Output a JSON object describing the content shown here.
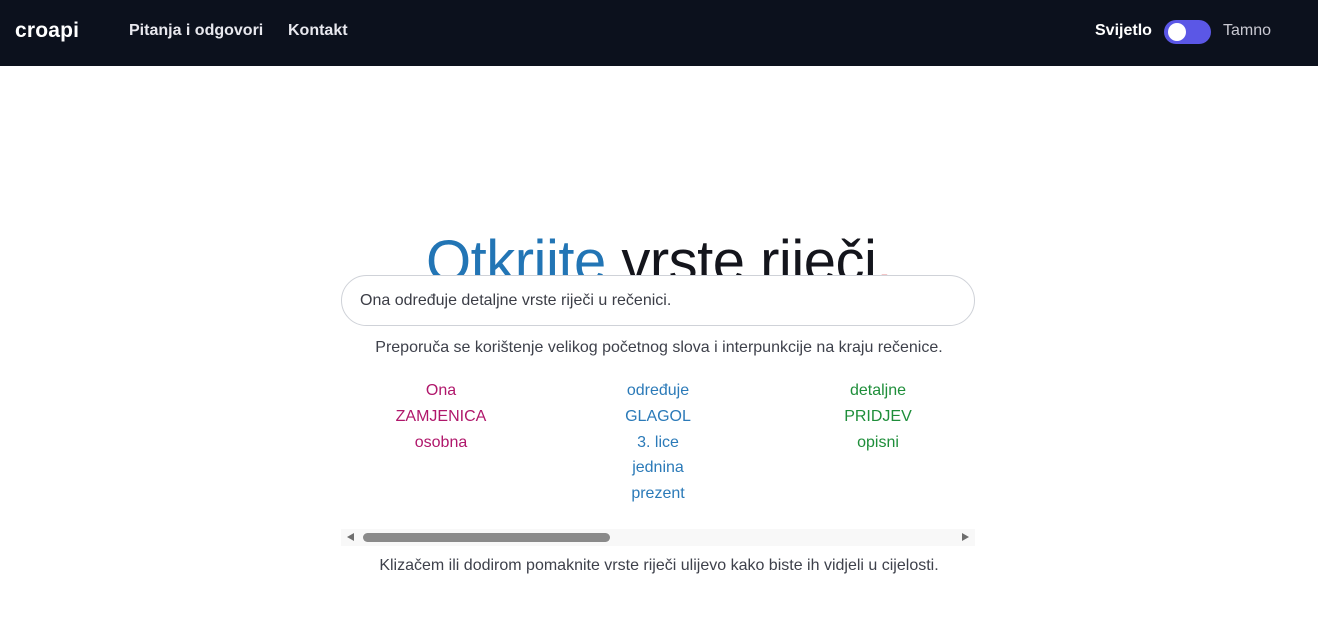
{
  "navbar": {
    "brand": "croapi",
    "links": [
      "Pitanja i odgovori",
      "Kontakt"
    ],
    "theme_light_label": "Svijetlo",
    "theme_dark_label": "Tamno",
    "toggle_color": "#5b57e6"
  },
  "hero": {
    "title_accent": "Otkrijte",
    "title_rest": " vrste riječi",
    "title_dot": ".",
    "accent_color": "#2275b5",
    "dot_color": "#d7262b"
  },
  "input": {
    "value": "Ona određuje detaljne vrste riječi u rečenici."
  },
  "hint": "Preporuča se korištenje velikog početnog slova i interpunkcije na kraju rečenice.",
  "words": [
    {
      "color": "#b0176b",
      "lines": [
        "Ona",
        "ZAMJENICA",
        "osobna"
      ]
    },
    {
      "color": "#2b7ab8",
      "lines": [
        "određuje",
        "GLAGOL",
        "3. lice",
        "jednina",
        "prezent"
      ]
    },
    {
      "color": "#1e8e3a",
      "lines": [
        "detaljne",
        "PRIDJEV",
        "opisni"
      ]
    }
  ],
  "scroll_hint": "Klizačem ili dodirom pomaknite vrste riječi ulijevo kako biste ih vidjeli u cijelosti."
}
